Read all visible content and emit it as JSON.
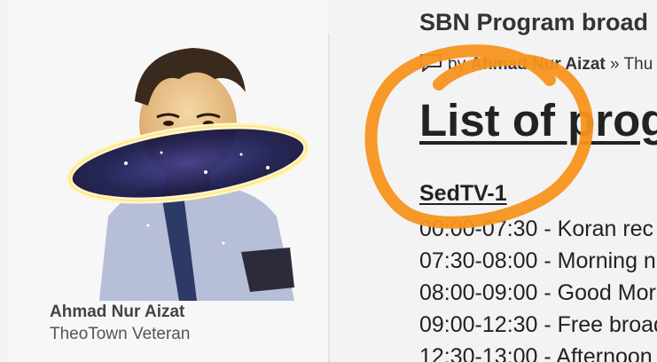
{
  "author": {
    "name": "Ahmad Nur Aizat",
    "rank": "TheoTown Veteran"
  },
  "thread": {
    "title": "SBN Program broad",
    "meta_by": "by",
    "meta_author": "Ahmad Nur Aizat",
    "meta_sep": "» Thu"
  },
  "post": {
    "heading": "List of prog",
    "channel": "SedTV-1",
    "schedule": [
      {
        "text": "00:00-07:30 - Koran rec"
      },
      {
        "text": "07:30-08:00 - Morning n"
      },
      {
        "text": "08:00-09:00 - Good Mor"
      },
      {
        "text": "09:00-12:30 - Free broad"
      },
      {
        "text": "12:30-13:00 - Afternoon"
      }
    ]
  },
  "icons": {
    "meta": "speech-bubble-icon"
  },
  "colors": {
    "annotation": "#f7931e",
    "text": "#222222",
    "background": "#f3f3f3"
  }
}
